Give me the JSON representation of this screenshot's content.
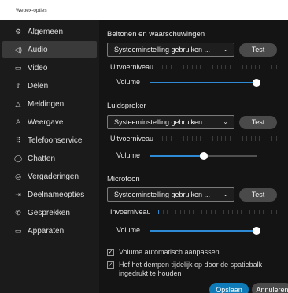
{
  "window": {
    "title": "Webex-opties"
  },
  "sidebar": {
    "items": [
      {
        "label": "Algemeen",
        "icon": "gear-icon",
        "glyph": "⚙"
      },
      {
        "label": "Audio",
        "icon": "speaker-icon",
        "glyph": "◁)"
      },
      {
        "label": "Video",
        "icon": "camera-icon",
        "glyph": "▭"
      },
      {
        "label": "Delen",
        "icon": "share-icon",
        "glyph": "⇧"
      },
      {
        "label": "Meldingen",
        "icon": "bell-icon",
        "glyph": "△"
      },
      {
        "label": "Weergave",
        "icon": "brush-icon",
        "glyph": "♙"
      },
      {
        "label": "Telefoonservice",
        "icon": "dialpad-icon",
        "glyph": "⠿"
      },
      {
        "label": "Chatten",
        "icon": "chat-icon",
        "glyph": "◯"
      },
      {
        "label": "Vergaderingen",
        "icon": "meetings-icon",
        "glyph": "◎"
      },
      {
        "label": "Deelnameopties",
        "icon": "join-icon",
        "glyph": "⇥"
      },
      {
        "label": "Gesprekken",
        "icon": "phone-icon",
        "glyph": "✆"
      },
      {
        "label": "Apparaten",
        "icon": "device-icon",
        "glyph": "▭"
      }
    ],
    "active": "Audio"
  },
  "ringtones": {
    "title": "Beltonen en waarschuwingen",
    "device": "Systeeminstelling gebruiken ...",
    "test_label": "Test",
    "level_label": "Uitvoerniveau",
    "volume_label": "Volume",
    "volume_fraction": 1.0,
    "level_lit": 0
  },
  "speaker": {
    "title": "Luidspreker",
    "device": "Systeeminstelling gebruiken ...",
    "test_label": "Test",
    "level_label": "Uitvoerniveau",
    "volume_label": "Volume",
    "volume_fraction": 0.5,
    "level_lit": 0
  },
  "microphone": {
    "title": "Microfoon",
    "device": "Systeeminstelling gebruiken ...",
    "test_label": "Test",
    "level_label": "Invoerniveau",
    "volume_label": "Volume",
    "volume_fraction": 1.0,
    "level_lit": 1
  },
  "options": {
    "auto_volume": {
      "label": "Volume automatisch aanpassen",
      "checked": true
    },
    "hold_to_unmute": {
      "label": "Hef het dempen tijdelijk op door de spatiebalk ingedrukt te houden",
      "checked": true
    }
  },
  "footer": {
    "save_label": "Opslaan",
    "cancel_label": "Annuleren"
  },
  "colors": {
    "accent": "#2f8ad6",
    "save_button": "#0e7ab8",
    "cancel_button": "#4a4a4a",
    "active_item": "#3a3a3a"
  }
}
